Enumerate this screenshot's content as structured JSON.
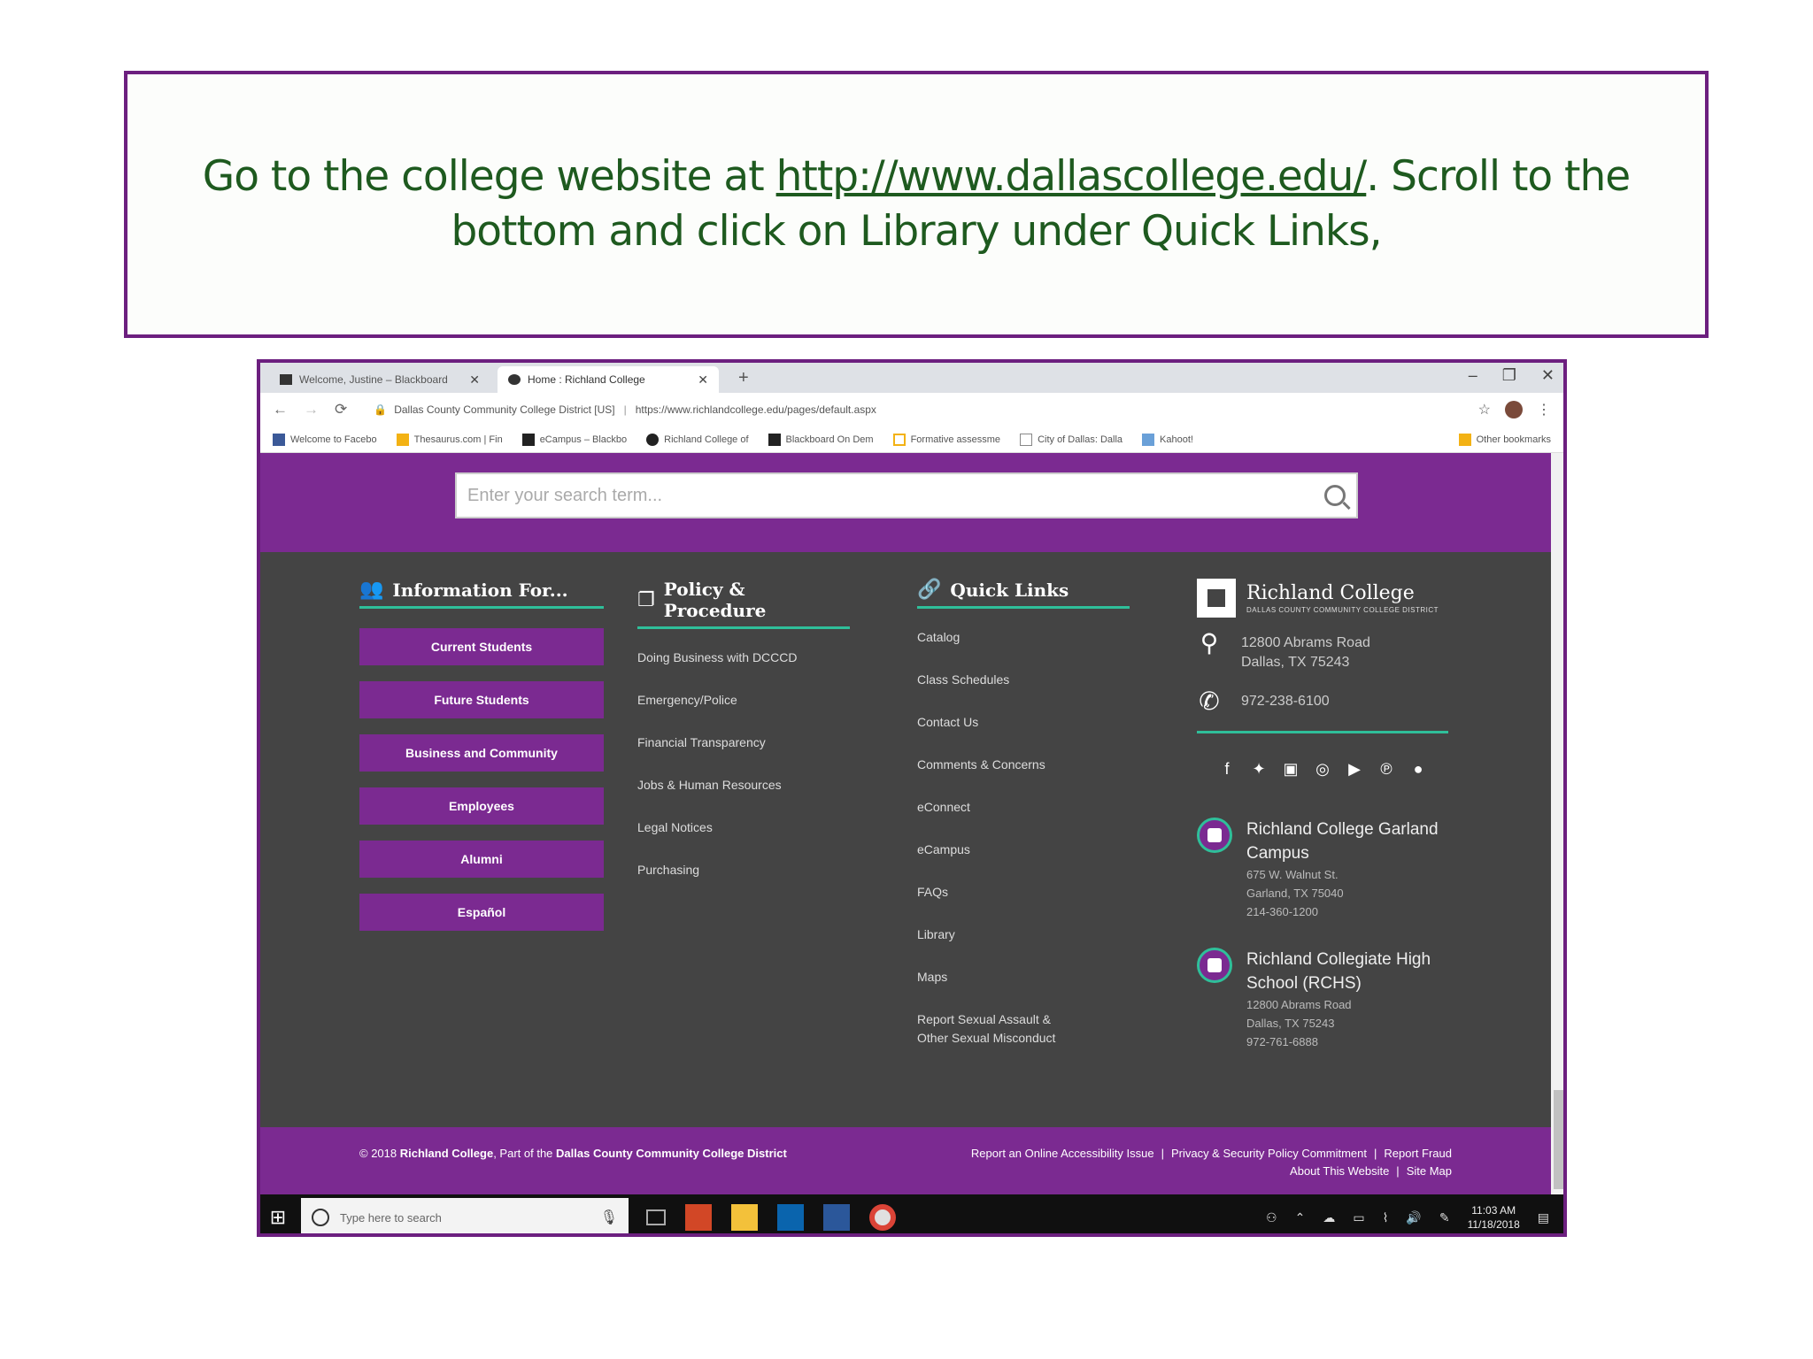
{
  "instruction": {
    "before": "Go to the college website at ",
    "url": "http://www.dallascollege.edu/",
    "after": ". Scroll to the bottom and click on Library under Quick Links,"
  },
  "browser": {
    "tabs": [
      {
        "label": "Welcome, Justine – Blackboard"
      },
      {
        "label": "Home : Richland College"
      }
    ],
    "address_org": "Dallas County Community College District [US]",
    "address_url": "https://www.richlandcollege.edu/pages/default.aspx",
    "bookmarks": [
      "Welcome to Facebo",
      "Thesaurus.com | Fin",
      "eCampus – Blackbo",
      "Richland College of",
      "Blackboard On Dem",
      "Formative assessme",
      "City of Dallas: Dalla",
      "Kahoot!",
      "Other bookmarks"
    ]
  },
  "search": {
    "placeholder": "Enter your search term..."
  },
  "footer": {
    "info": {
      "heading": "Information For...",
      "buttons": [
        "Current Students",
        "Future Students",
        "Business and Community",
        "Employees",
        "Alumni",
        "Español"
      ]
    },
    "policy": {
      "heading": "Policy & Procedure",
      "links": [
        "Doing Business with DCCCD",
        "Emergency/Police",
        "Financial Transparency",
        "Jobs & Human Resources",
        "Legal Notices",
        "Purchasing"
      ]
    },
    "quick": {
      "heading": "Quick Links",
      "links": [
        "Catalog",
        "Class Schedules",
        "Contact Us",
        "Comments & Concerns",
        "eConnect",
        "eCampus",
        "FAQs",
        "Library",
        "Maps"
      ],
      "last_line1": "Report Sexual Assault &",
      "last_line2": "Other Sexual Misconduct"
    },
    "college": {
      "name": "Richland College",
      "sub": "DALLAS COUNTY COMMUNITY COLLEGE DISTRICT",
      "address1": "12800 Abrams Road",
      "address2": "Dallas, TX 75243",
      "phone": "972-238-6100",
      "campuses": [
        {
          "name": "Richland College Garland Campus",
          "line1": "675 W. Walnut St.",
          "line2": "Garland, TX 75040",
          "line3": "214-360-1200"
        },
        {
          "name": "Richland Collegiate High School (RCHS)",
          "line1": "12800 Abrams Road",
          "line2": "Dallas, TX 75243",
          "line3": "972-761-6888"
        }
      ]
    }
  },
  "bottom": {
    "copy_pre": "© 2018 ",
    "copy_college": "Richland College",
    "copy_mid": ", Part of the ",
    "copy_district": "Dallas County Community College District",
    "legal1": "Report an Online Accessibility Issue",
    "legal2": "Privacy & Security Policy Commitment",
    "legal3": "Report Fraud",
    "legal4": "About This Website",
    "legal5": "Site Map"
  },
  "taskbar": {
    "search_placeholder": "Type here to search",
    "time": "11:03 AM",
    "date": "11/18/2018"
  },
  "colors": {
    "purple": "#7b2a91",
    "frame": "#6c1f7f",
    "text_green": "#1e5a1f",
    "accent_green": "#2fbf9a",
    "footer_bg": "#444444"
  }
}
